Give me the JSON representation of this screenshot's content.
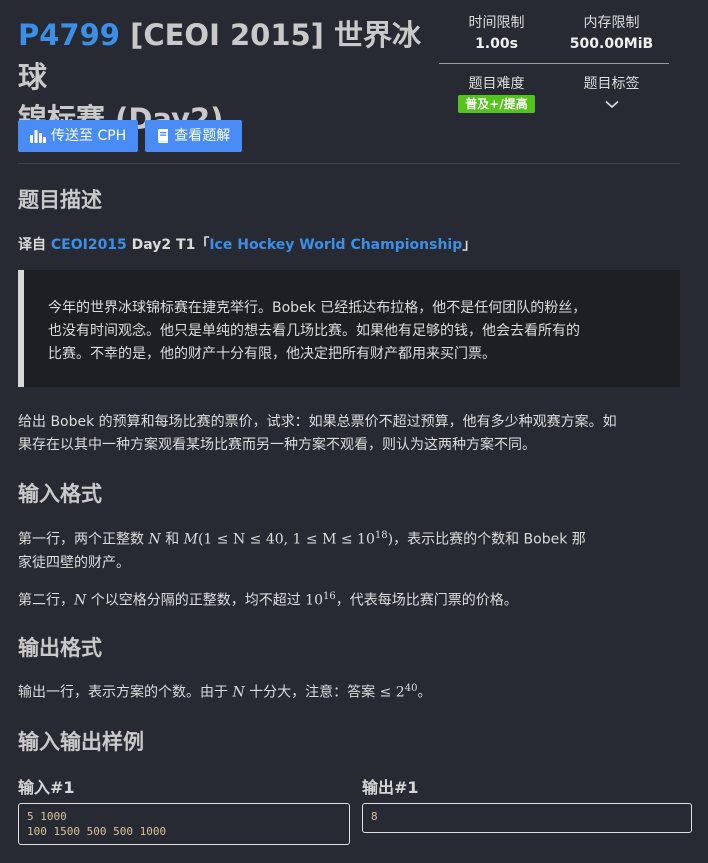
{
  "problem": {
    "id": "P4799",
    "title_main": "[CEOI 2015] 世界冰球",
    "title_line2": "锦标赛 (Day2)"
  },
  "buttons": {
    "send_cph": "传送至 CPH",
    "view_solution": "查看题解"
  },
  "meta": {
    "time_label": "时间限制",
    "time_value": "1.00s",
    "memory_label": "内存限制",
    "memory_value": "500.00MiB",
    "difficulty_label": "题目难度",
    "difficulty_value": "普及+/提高",
    "difficulty_color": "#52c41a",
    "tags_label": "题目标签"
  },
  "description": {
    "heading": "题目描述",
    "source_prefix": "译自 ",
    "source_contest": "CEOI2015",
    "source_mid": " Day2 T1「",
    "source_title": "Ice Hockey World Championship",
    "source_suffix": "」",
    "quote_line1": "今年的世界冰球锦标赛在捷克举行。Bobek 已经抵达布拉格，他不是任何团队的粉丝，",
    "quote_line2": "也没有时间观念。他只是单纯的想去看几场比赛。如果他有足够的钱，他会去看所有的",
    "quote_line3": "比赛。不幸的是，他的财产十分有限，他决定把所有财产都用来买门票。",
    "para_line1": "给出 Bobek 的预算和每场比赛的票价，试求：如果总票价不超过预算，他有多少种观赛方案。如",
    "para_line2": "果存在以其中一种方案观看某场比赛而另一种方案不观看，则认为这两种方案不同。"
  },
  "input_format": {
    "heading": "输入格式",
    "line1_a": "第一行，两个正整数 ",
    "line1_b": " 和 ",
    "line1_c": "，表示比赛的个数和 Bobek 那",
    "line1_d": "家徒四壁的财产。",
    "line2_a": "第二行，",
    "line2_b": " 个以空格分隔的正整数，均不超过 ",
    "line2_c": "，代表每场比赛门票的价格。",
    "var_n": "N",
    "var_m": "M",
    "constraint": "(1 ≤ N ≤ 40, 1 ≤ M ≤ 10",
    "exp18": "18",
    "close": ")",
    "ten": "10",
    "exp16": "16"
  },
  "output_format": {
    "heading": "输出格式",
    "line_a": "输出一行，表示方案的个数。由于 ",
    "line_b": " 十分大，注意：答案 ",
    "le": "≤",
    "two": "2",
    "exp40": "40",
    "line_c": "。"
  },
  "samples": {
    "heading": "输入输出样例",
    "input_label": "输入#1",
    "output_label": "输出#1",
    "input_text": "5 1000\n100 1500 500 500 1000",
    "output_text": "8"
  }
}
